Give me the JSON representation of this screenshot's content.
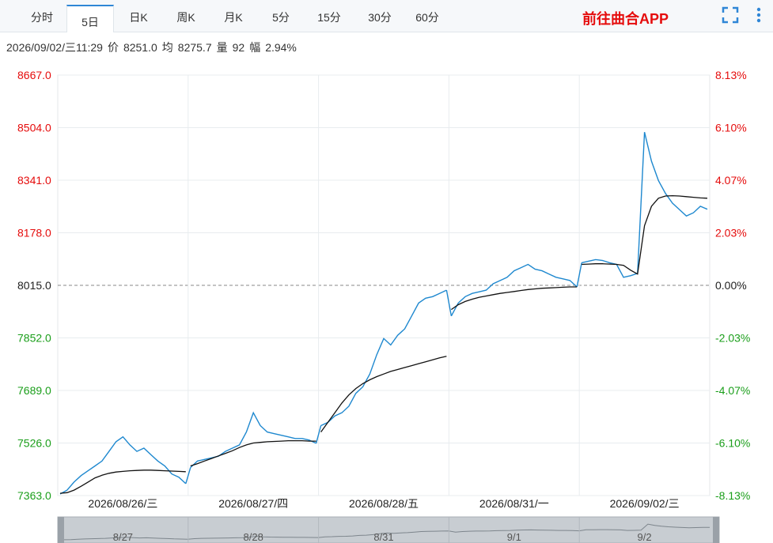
{
  "tabs": [
    {
      "label": "分时",
      "active": false
    },
    {
      "label": "5日",
      "active": true
    },
    {
      "label": "日K",
      "active": false
    },
    {
      "label": "周K",
      "active": false
    },
    {
      "label": "月K",
      "active": false
    },
    {
      "label": "5分",
      "active": false
    },
    {
      "label": "15分",
      "active": false
    },
    {
      "label": "30分",
      "active": false
    },
    {
      "label": "60分",
      "active": false
    }
  ],
  "app_link": "前往曲合APP",
  "icons": {
    "fullscreen": "fullscreen-icon",
    "more": "more-vertical-icon"
  },
  "info": {
    "datetime": "2026/09/02/三11:29",
    "price_label": "价",
    "price": "8251.0",
    "avg_label": "均",
    "avg": "8275.7",
    "volume_label": "量",
    "volume": "92",
    "change_label": "幅",
    "change": "2.94%"
  },
  "colors": {
    "up": "#e50c0c",
    "down": "#1a9e1a",
    "price_line": "#1e88cf",
    "avg_line": "#111111",
    "accent": "#2f86d6"
  },
  "chart_data": {
    "type": "line",
    "base_price": 8015.0,
    "ylim": [
      7363.0,
      8667.0
    ],
    "y_ticks": [
      "8667.0",
      "8504.0",
      "8341.0",
      "8178.0",
      "8015.0",
      "7852.0",
      "7689.0",
      "7526.0",
      "7363.0"
    ],
    "pct_ticks": [
      "8.13%",
      "6.10%",
      "4.07%",
      "2.03%",
      "0.00%",
      "-2.03%",
      "-4.07%",
      "-6.10%",
      "-8.13%"
    ],
    "days": [
      "2026/08/26/三",
      "2026/08/27/四",
      "2026/08/28/五",
      "2026/08/31/一",
      "2026/09/02/三"
    ],
    "navigator_labels": [
      "8/27",
      "8/28",
      "8/31",
      "9/1",
      "9/2"
    ],
    "series": [
      {
        "key": "price",
        "values": [
          [
            7368,
            7380,
            7405,
            7425,
            7440,
            7455,
            7470,
            7500,
            7530,
            7545,
            7520,
            7500,
            7510,
            7490,
            7470,
            7455,
            7430,
            7420,
            7400
          ],
          [
            7450,
            7470,
            7475,
            7480,
            7485,
            7500,
            7510,
            7520,
            7560,
            7620,
            7580,
            7560,
            7555,
            7550,
            7545,
            7540,
            7540,
            7535,
            7525
          ],
          [
            7580,
            7590,
            7610,
            7620,
            7640,
            7680,
            7700,
            7740,
            7800,
            7850,
            7830,
            7860,
            7880,
            7920,
            7960,
            7975,
            7980,
            7990,
            8000
          ],
          [
            7920,
            7960,
            7980,
            7990,
            7995,
            8000,
            8020,
            8030,
            8040,
            8060,
            8070,
            8080,
            8065,
            8060,
            8050,
            8040,
            8035,
            8030,
            8010
          ],
          [
            8085,
            8090,
            8095,
            8092,
            8085,
            8080,
            8040,
            8045,
            8052,
            8490,
            8400,
            8340,
            8300,
            8270,
            8250,
            8230,
            8240,
            8260,
            8251
          ]
        ]
      },
      {
        "key": "avg",
        "values": [
          [
            7370,
            7372,
            7380,
            7392,
            7405,
            7418,
            7426,
            7432,
            7436,
            7438,
            7440,
            7441,
            7442,
            7442,
            7441,
            7440,
            7439,
            7438,
            7437
          ],
          [
            7455,
            7462,
            7470,
            7478,
            7486,
            7494,
            7502,
            7512,
            7520,
            7526,
            7528,
            7530,
            7531,
            7532,
            7533,
            7533,
            7533,
            7532,
            7532
          ],
          [
            7560,
            7590,
            7620,
            7650,
            7675,
            7695,
            7710,
            7722,
            7732,
            7740,
            7748,
            7754,
            7760,
            7766,
            7772,
            7778,
            7784,
            7790,
            7795
          ],
          [
            7940,
            7955,
            7965,
            7972,
            7978,
            7982,
            7986,
            7990,
            7993,
            7996,
            7999,
            8002,
            8004,
            8006,
            8007,
            8008,
            8009,
            8010,
            8010
          ],
          [
            8080,
            8081,
            8082,
            8082,
            8081,
            8080,
            8077,
            8062,
            8050,
            8200,
            8260,
            8285,
            8292,
            8293,
            8292,
            8290,
            8288,
            8286,
            8285
          ]
        ]
      }
    ]
  }
}
